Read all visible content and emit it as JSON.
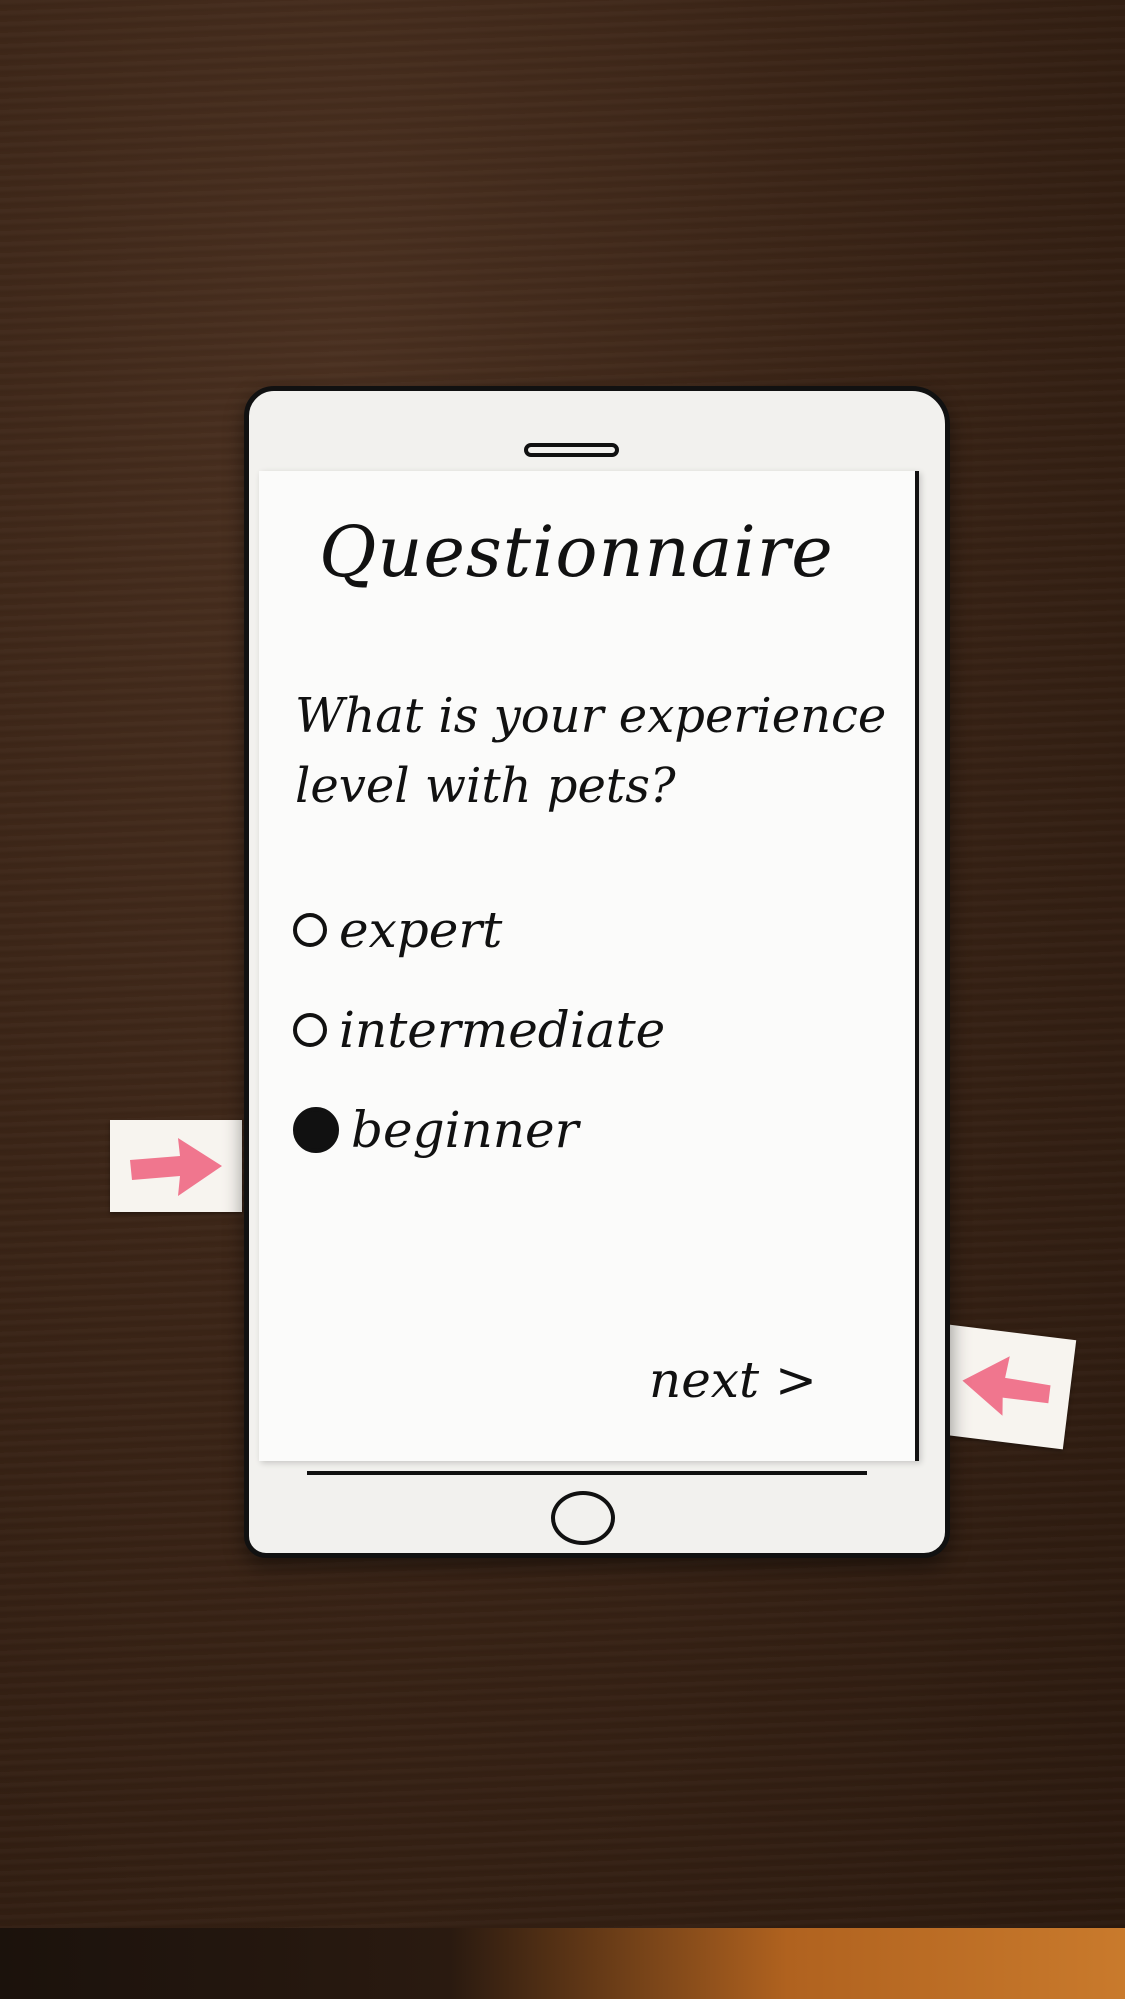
{
  "questionnaire": {
    "title": "Questionnaire",
    "question": "What is your experience level with pets?",
    "options": [
      {
        "label": "expert",
        "selected": false
      },
      {
        "label": "intermediate",
        "selected": false
      },
      {
        "label": "beginner",
        "selected": true
      }
    ],
    "next_label": "next >"
  },
  "colors": {
    "ink": "#111111",
    "paper": "#fbfbfa",
    "arrow_pink": "#ef6a86",
    "table_wood": "#3a2416"
  },
  "icons": {
    "speaker": "speaker-slot-icon",
    "home": "home-button-icon",
    "left_arrow_note": "pink-arrow-right-icon",
    "right_arrow_note": "pink-arrow-left-icon"
  }
}
